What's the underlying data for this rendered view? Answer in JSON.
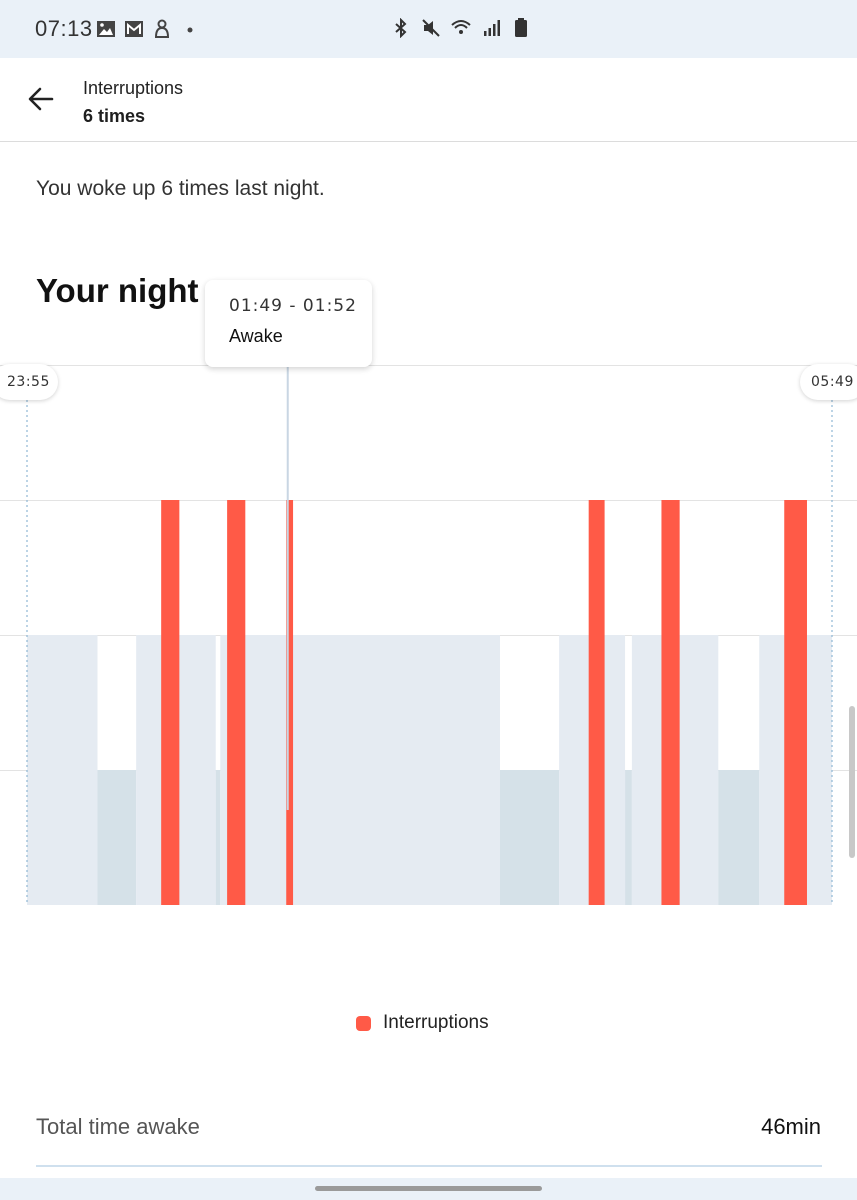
{
  "status_bar": {
    "time": "07:13",
    "left_icons": [
      "gallery-icon",
      "mail-icon",
      "app-notification-icon",
      "dot-icon"
    ],
    "right_icons": [
      "bluetooth-icon",
      "mute-icon",
      "wifi-icon",
      "signal-icon",
      "battery-icon"
    ]
  },
  "app_bar": {
    "back_icon": "arrow-left-icon",
    "title": "Interruptions",
    "subtitle": "6 times"
  },
  "summary": "You woke up 6 times last night.",
  "section_title": "Your night",
  "tooltip": {
    "time_range": "01:49 - 01:52",
    "state": "Awake"
  },
  "chart_data": {
    "type": "bar",
    "start_label": "23:55",
    "end_label": "05:49",
    "x_range": [
      "23:55",
      "05:49"
    ],
    "levels": 4,
    "grid": true,
    "colors": {
      "interruption": "#ff5a47",
      "sleep": "#e5ebf2",
      "deep": "#d5e1e8",
      "selection": "#c9d6e3"
    },
    "sleep_stages": [
      {
        "start": "23:55",
        "end": "00:26",
        "level": 2
      },
      {
        "start": "00:26",
        "end": "00:43",
        "level": 1
      },
      {
        "start": "00:43",
        "end": "01:18",
        "level": 2
      },
      {
        "start": "01:18",
        "end": "01:20",
        "level": 1
      },
      {
        "start": "01:20",
        "end": "03:23",
        "level": 2
      },
      {
        "start": "03:23",
        "end": "03:49",
        "level": 1
      },
      {
        "start": "03:49",
        "end": "04:18",
        "level": 2
      },
      {
        "start": "04:18",
        "end": "04:21",
        "level": 1
      },
      {
        "start": "04:21",
        "end": "04:59",
        "level": 2
      },
      {
        "start": "04:59",
        "end": "05:17",
        "level": 1
      },
      {
        "start": "05:17",
        "end": "05:49",
        "level": 2
      }
    ],
    "interruptions": [
      {
        "start": "00:54",
        "end": "01:02"
      },
      {
        "start": "01:23",
        "end": "01:31"
      },
      {
        "start": "01:49",
        "end": "01:52",
        "selected": true
      },
      {
        "start": "04:02",
        "end": "04:09"
      },
      {
        "start": "04:34",
        "end": "04:42"
      },
      {
        "start": "05:28",
        "end": "05:38"
      }
    ],
    "legend": [
      {
        "name": "Interruptions",
        "color": "#ff5a47"
      }
    ]
  },
  "stats": {
    "label": "Total time awake",
    "value": "46min"
  }
}
